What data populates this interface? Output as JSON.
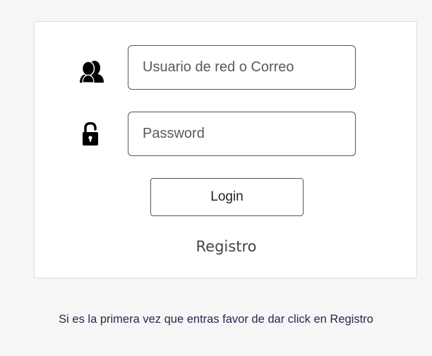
{
  "login_form": {
    "user_field": {
      "placeholder": "Usuario de red o Correo",
      "value": ""
    },
    "password_field": {
      "placeholder": "Password",
      "value": ""
    },
    "login_button_label": "Login",
    "register_link_label": "Registro",
    "icons": {
      "user": "users-icon",
      "password": "lock-icon"
    }
  },
  "hint": "Si es la primera vez que entras favor de dar click en Registro",
  "colors": {
    "page_background": "#f6f6f6",
    "card_background": "#ffffff",
    "hint_text": "#1e2a4a"
  }
}
